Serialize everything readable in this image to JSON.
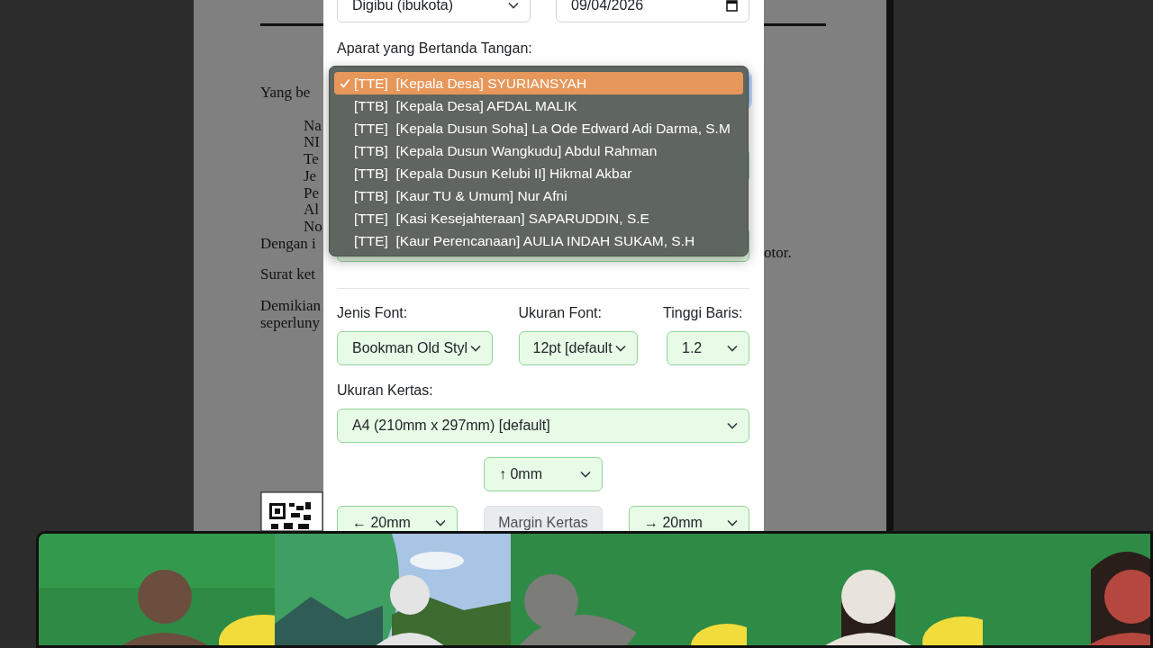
{
  "document": {
    "left_lines": [
      {
        "text": "Yang be",
        "kind": "paragraph"
      },
      {
        "text": "Na",
        "kind": "field"
      },
      {
        "text": "NI",
        "kind": "field"
      },
      {
        "text": "Te",
        "kind": "field"
      },
      {
        "text": "Je",
        "kind": "field"
      },
      {
        "text": "Pe",
        "kind": "field"
      },
      {
        "text": "Al",
        "kind": "field"
      },
      {
        "text": "No",
        "kind": "field"
      },
      {
        "text": "Dengan i",
        "kind": "line"
      },
      {
        "text": "Surat ket",
        "kind": "paragraph"
      },
      {
        "text": "Demikian",
        "kind": "paragraph"
      },
      {
        "text": "seperluny",
        "kind": "line"
      }
    ],
    "right_lines": [
      {
        "text": "otor.",
        "kind": "line"
      }
    ]
  },
  "form": {
    "region_select": "Digibu (ibukota)",
    "date": "09/04/2026",
    "signer_label": "Aparat yang Bertanda Tangan:",
    "signer_options": [
      {
        "text": "[TTE]  [Kepala Desa] SYURIANSYAH",
        "selected": true
      },
      {
        "text": "[TTB]  [Kepala Desa] AFDAL MALIK",
        "selected": false
      },
      {
        "text": "[TTE]  [Kepala Dusun Soha] La Ode Edward Adi Darma, S.M",
        "selected": false
      },
      {
        "text": "[TTB]  [Kepala Dusun Wangkudu] Abdul Rahman",
        "selected": false
      },
      {
        "text": "[TTB]  [Kepala Dusun Kelubi II] Hikmal Akbar",
        "selected": false
      },
      {
        "text": "[TTB]  [Kaur TU & Umum] Nur Afni",
        "selected": false
      },
      {
        "text": "[TTE]  [Kasi Kesejahteraan] SAPARUDDIN, S.E",
        "selected": false
      },
      {
        "text": "[TTE]  [Kaur Perencanaan] AULIA INDAH SUKAM, S.H",
        "selected": false
      }
    ],
    "font_label": "Jenis Font:",
    "font_value": "Bookman Old Styl",
    "size_label": "Ukuran Font:",
    "size_value": "12pt [default",
    "line_label": "Tinggi Baris:",
    "line_value": "1.2",
    "paper_label": "Ukuran Kertas:",
    "paper_value": "A4 (210mm x 297mm) [default]",
    "margin_top": "↑ 0mm",
    "margin_left": "← 20mm",
    "margin_button": "Margin Kertas",
    "margin_right": "→ 20mm"
  }
}
